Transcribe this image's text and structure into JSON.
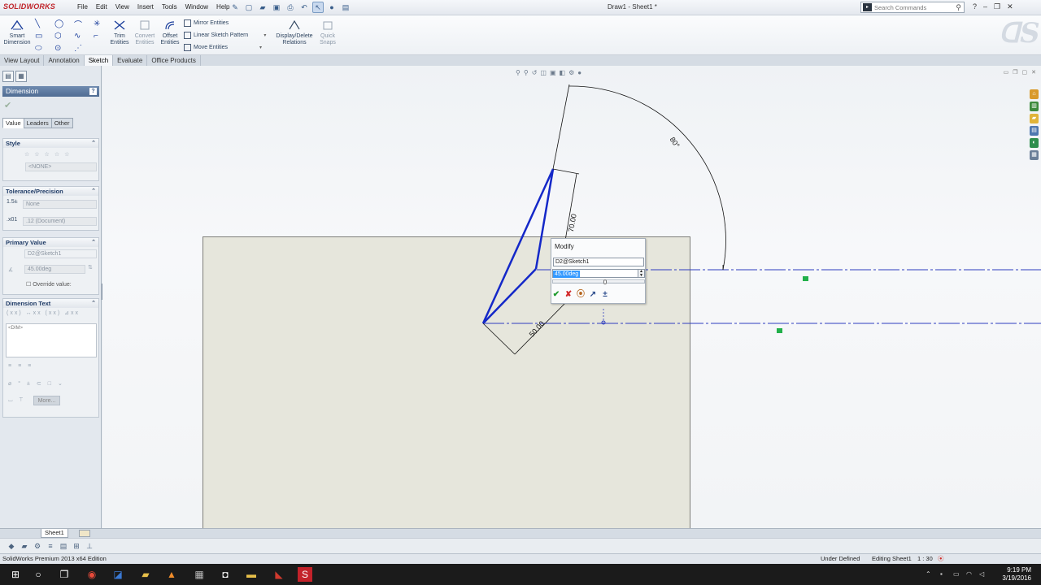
{
  "app": {
    "brand": "SOLIDWORKS",
    "doc_title": "Draw1 - Sheet1 *"
  },
  "menus": [
    "File",
    "Edit",
    "View",
    "Insert",
    "Tools",
    "Window",
    "Help"
  ],
  "search": {
    "placeholder": "Search Commands"
  },
  "ribbon": {
    "smart_dimension": "Smart\nDimension",
    "trim_entities": "Trim\nEntities",
    "convert_entities": "Convert\nEntities",
    "offset_entities": "Offset\nEntities",
    "mirror_entities": "Mirror Entities",
    "linear_sketch_pattern": "Linear Sketch Pattern",
    "move_entities": "Move Entities",
    "display_delete_relations": "Display/Delete\nRelations",
    "quick_snaps": "Quick\nSnaps"
  },
  "tabs": [
    "View Layout",
    "Annotation",
    "Sketch",
    "Evaluate",
    "Office Products"
  ],
  "active_tab": "Sketch",
  "property_manager": {
    "title": "Dimension",
    "subtabs": [
      "Value",
      "Leaders",
      "Other"
    ],
    "style": {
      "title": "Style",
      "value": "<NONE>"
    },
    "tolerance": {
      "title": "Tolerance/Precision",
      "tolerance_value": "None",
      "precision_value": ".12 (Document)"
    },
    "primary_value": {
      "title": "Primary Value",
      "name": "D2@Sketch1",
      "value": "45.00deg",
      "override_label": "Override value:"
    },
    "dimension_text": {
      "title": "Dimension Text",
      "dim_token": "<DIM>",
      "more_button": "More..."
    }
  },
  "drawing": {
    "dim_angle": "80°",
    "dim_vertical": "70.00",
    "dim_diagonal": "50.00",
    "colors": {
      "sketch": "#1428c8",
      "centerline": "#2d3cbf",
      "sheet": "#e6e6dc",
      "dims": "#111111"
    }
  },
  "modify_dialog": {
    "title": "Modify",
    "dim_name": "D2@Sketch1",
    "value": "45.00deg"
  },
  "sheet_tab": "Sheet1",
  "status": {
    "edition": "SolidWorks Premium 2013 x64 Edition",
    "state": "Under Defined",
    "editing": "Editing Sheet1",
    "scale": "1 : 30"
  },
  "clock": {
    "time": "9:19 PM",
    "date": "3/19/2016"
  }
}
